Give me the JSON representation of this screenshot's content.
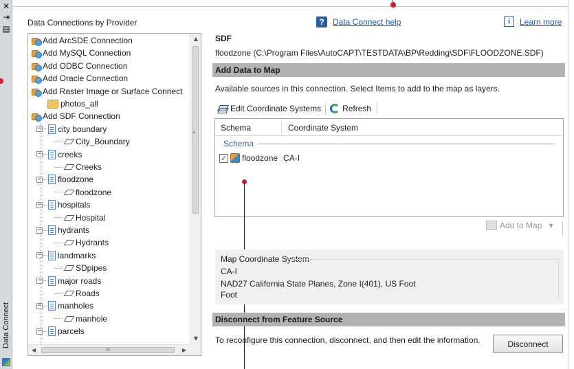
{
  "palette": {
    "title": "Data Connect",
    "close_glyph": "✕",
    "autohide_glyph": "⇥",
    "menu_glyph": "▤"
  },
  "tree": {
    "header": "Data Connections by Provider",
    "items": [
      {
        "label": "Add ArcSDE Connection",
        "icon": "add-connection-icon",
        "level": 0
      },
      {
        "label": "Add MySQL Connection",
        "icon": "add-connection-icon",
        "level": 0
      },
      {
        "label": "Add ODBC Connection",
        "icon": "add-connection-icon",
        "level": 0
      },
      {
        "label": "Add Oracle Connection",
        "icon": "add-connection-icon",
        "level": 0
      },
      {
        "label": "Add Raster Image or Surface Connect",
        "icon": "add-raster-connection-icon",
        "level": 0
      },
      {
        "label": "photos_all",
        "icon": "folder-icon",
        "level": 1
      },
      {
        "label": "Add SDF Connection",
        "icon": "add-connection-icon",
        "level": 0
      },
      {
        "label": "city boundary",
        "icon": "document-icon",
        "level": 1,
        "expander": "−"
      },
      {
        "label": "City_Boundary",
        "icon": "layer-icon",
        "level": 2
      },
      {
        "label": "creeks",
        "icon": "document-icon",
        "level": 1,
        "expander": "−"
      },
      {
        "label": "Creeks",
        "icon": "layer-icon",
        "level": 2
      },
      {
        "label": "floodzone",
        "icon": "document-icon",
        "level": 1,
        "expander": "−",
        "selected": true
      },
      {
        "label": "floodzone",
        "icon": "layer-icon",
        "level": 2
      },
      {
        "label": "hospitals",
        "icon": "document-icon",
        "level": 1,
        "expander": "−"
      },
      {
        "label": "Hospital",
        "icon": "layer-icon",
        "level": 2
      },
      {
        "label": "hydrants",
        "icon": "document-icon",
        "level": 1,
        "expander": "−"
      },
      {
        "label": "Hydrants",
        "icon": "layer-icon",
        "level": 2
      },
      {
        "label": "landmarks",
        "icon": "document-icon",
        "level": 1,
        "expander": "−"
      },
      {
        "label": "SDpipes",
        "icon": "layer-icon",
        "level": 2
      },
      {
        "label": "major roads",
        "icon": "document-icon",
        "level": 1,
        "expander": "−"
      },
      {
        "label": "Roads",
        "icon": "layer-icon",
        "level": 2
      },
      {
        "label": "manholes",
        "icon": "document-icon",
        "level": 1,
        "expander": "−"
      },
      {
        "label": "manhole",
        "icon": "layer-icon",
        "level": 2
      },
      {
        "label": "parcels",
        "icon": "document-icon",
        "level": 1,
        "expander": "−"
      }
    ],
    "hscroll_grip": "III",
    "vscroll_grip": "≡"
  },
  "links": {
    "help": "Data Connect help",
    "help_icon": "?",
    "learn_more": "Learn more",
    "info_icon": "i"
  },
  "connection": {
    "title": "SDF",
    "path": "floodzone (C:\\Program Files\\AutoCAPT\\TESTDATA\\BP\\Redding\\SDF\\FLOODZONE.SDF)"
  },
  "add_data": {
    "section_title": "Add Data to Map",
    "instructions": "Available sources in this connection.  Select Items to add to the map as layers.",
    "toolbar": {
      "edit_cs": "Edit Coordinate Systems",
      "refresh": "Refresh"
    },
    "grid": {
      "columns": [
        "Schema",
        "Coordinate System"
      ],
      "group": "Schema",
      "rows": [
        {
          "checked": true,
          "name": "floodzone",
          "cs": "CA-I"
        }
      ]
    },
    "add_to_map": "Add to Map"
  },
  "map_cs": {
    "legend": "Map Coordinate System",
    "code": "CA-I",
    "description": "NAD27 California State Planes, Zone I(401), US Foot",
    "units": "Foot"
  },
  "disconnect": {
    "section_title": "Disconnect from Feature Source",
    "text": "To reconfigure this connection, disconnect, and then edit the information.",
    "button": "Disconnect"
  },
  "colors": {
    "section_bar": "#b2b2b2",
    "link": "#1a5fb4",
    "callout": "#d21f33",
    "group_blue": "#3c66ab"
  }
}
